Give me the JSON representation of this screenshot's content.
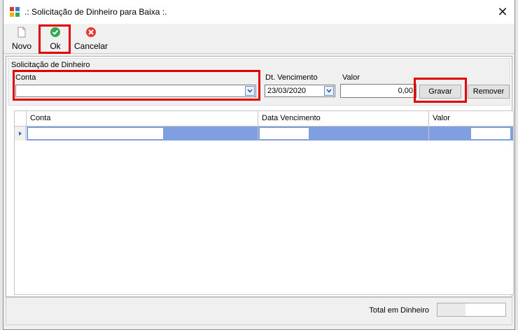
{
  "window": {
    "title": ".: Solicitação de Dinheiro para Baixa  :."
  },
  "toolbar": {
    "novo_label": "Novo",
    "ok_label": "Ok",
    "cancelar_label": "Cancelar"
  },
  "group": {
    "title": "Solicitação de Dinheiro",
    "conta_label": "Conta",
    "conta_value": "",
    "dt_venc_label": "Dt. Vencimento",
    "dt_venc_value": "23/03/2020",
    "valor_label": "Valor",
    "valor_value": "0,00",
    "gravar_label": "Gravar",
    "remover_label": "Remover"
  },
  "grid": {
    "columns": [
      "Conta",
      "Data Vencimento",
      "Valor"
    ]
  },
  "footer": {
    "total_label": "Total em Dinheiro",
    "total_value": ""
  },
  "colors": {
    "highlight": "#e00000",
    "selection": "#7f9fe0",
    "ok_green": "#34a853",
    "cancel_red": "#e53935"
  }
}
